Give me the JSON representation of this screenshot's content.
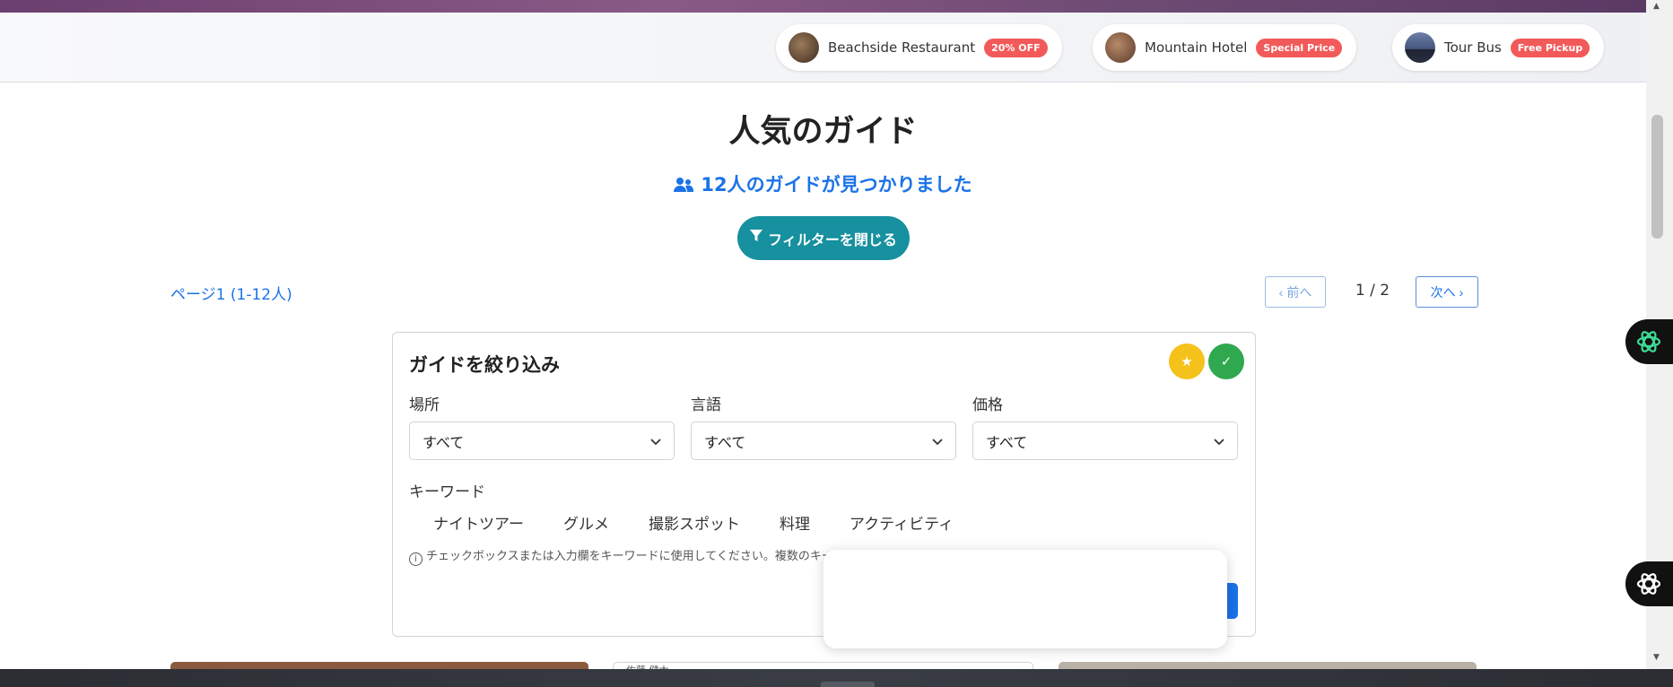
{
  "sponsors": [
    {
      "name": "Beachside Restaurant",
      "tag": "20% OFF"
    },
    {
      "name": "Mountain Hotel",
      "tag": "Special Price"
    },
    {
      "name": "Tour Bus",
      "tag": "Free Pickup"
    }
  ],
  "header": {
    "title": "人気のガイド",
    "found": "12人のガイドが見つかりました",
    "filter_button": "フィルターを閉じる"
  },
  "pagination": {
    "info": "ページ1 (1-12人)",
    "prev": "前へ",
    "current": "1 / 2",
    "next": "次へ"
  },
  "filter_panel": {
    "title": "ガイドを絞り込み",
    "location_label": "場所",
    "location_value": "すべて",
    "language_label": "言語",
    "language_value": "すべて",
    "price_label": "価格",
    "price_value": "すべて",
    "keyword_label": "キーワード",
    "keywords": [
      "ナイトツアー",
      "グルメ",
      "撮影スポット",
      "料理",
      "アクティビティ"
    ],
    "hint": "チェックボックスまたは入力欄をキーワードに使用してください。複数のキーワ"
  },
  "cards": {
    "card2_partial_text": "佐藤 健太"
  },
  "colors": {
    "accent_blue": "#1a73e8",
    "filter_button": "#17909f",
    "tag_red": "#f25a5a",
    "star_yellow": "#f5c21b",
    "check_green": "#2fa84f"
  },
  "icons": {
    "users": "users-icon",
    "filter": "filter-icon",
    "chevron_down": "chevron-down-icon",
    "star": "star-icon",
    "check": "check-icon",
    "info": "info-icon",
    "ai_assistant": "ai-assistant-icon"
  }
}
